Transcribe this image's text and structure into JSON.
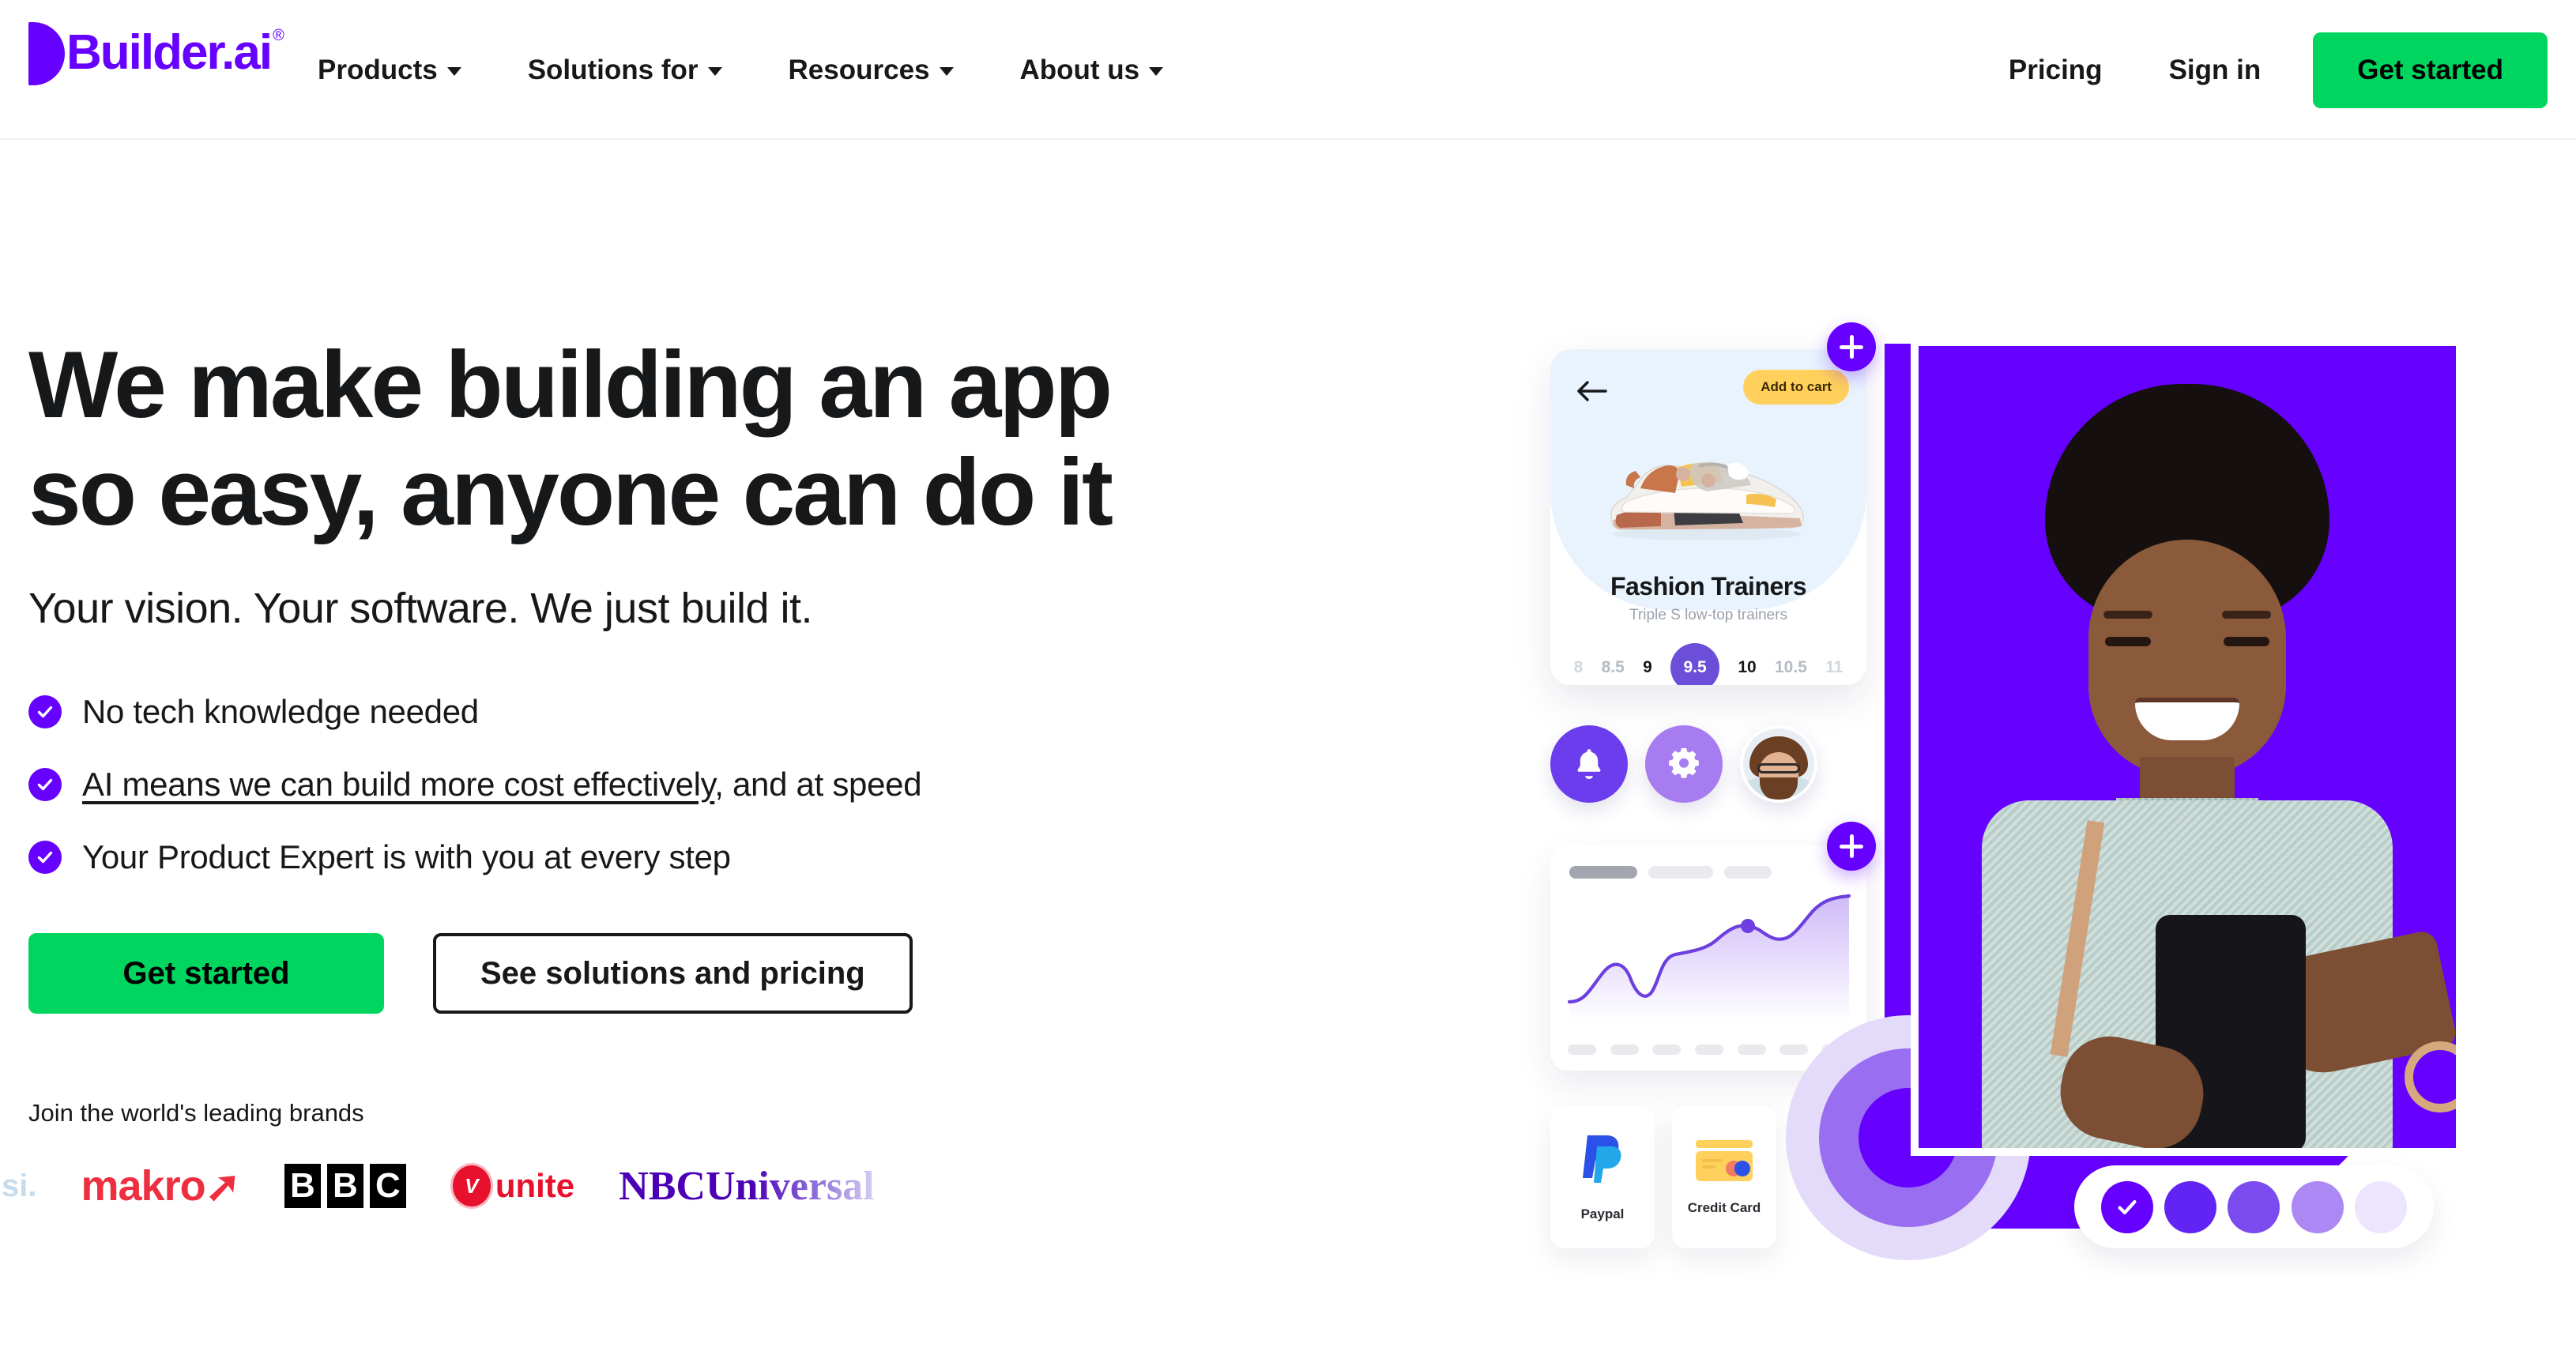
{
  "header": {
    "logo": {
      "text": "Builder.ai",
      "trademark": "®",
      "color": "#6600ff"
    },
    "nav": [
      {
        "label": "Products",
        "has_dropdown": true
      },
      {
        "label": "Solutions for",
        "has_dropdown": true
      },
      {
        "label": "Resources",
        "has_dropdown": true
      },
      {
        "label": "About us",
        "has_dropdown": true
      }
    ],
    "pricing_label": "Pricing",
    "signin_label": "Sign in",
    "get_started_label": "Get started",
    "cta_color": "#00d65f"
  },
  "hero": {
    "headline": "We make building an app\nso easy, anyone can do it",
    "subhead": "Your vision. Your software. We just build it.",
    "checklist": [
      {
        "text": "No tech knowledge needed",
        "underlined": ""
      },
      {
        "underlined": "AI means we can build more cost effectively",
        "text": ", and at speed"
      },
      {
        "text": "Your Product Expert is with you at every step",
        "underlined": ""
      }
    ],
    "primary_cta": "Get started",
    "secondary_cta": "See solutions and pricing",
    "brands_label": "Join the world's leading brands",
    "brands": [
      {
        "name": "pepsi",
        "text": "si.",
        "color": "#c6dcec"
      },
      {
        "name": "makro",
        "text": "makro",
        "color": "#ee2f3f"
      },
      {
        "name": "bbc",
        "letters": [
          "B",
          "B",
          "C"
        ],
        "color": "#000000"
      },
      {
        "name": "virgin-unite",
        "mark": "V",
        "text": "unite",
        "color": "#e8112d"
      },
      {
        "name": "nbcuniversal",
        "text": "NBCUniversal",
        "color": "#4b00b5"
      }
    ]
  },
  "illustration": {
    "shoe_card": {
      "back_icon": "arrow-left-icon",
      "add_to_cart": "Add to cart",
      "title": "Fashion Trainers",
      "subtitle": "Triple S low-top trainers",
      "sizes": [
        "8",
        "8.5",
        "9",
        "9.5",
        "10",
        "10.5",
        "11"
      ],
      "selected_size": "9.5",
      "selected_color": "#6c4fd8"
    },
    "icons": [
      {
        "name": "bell-icon",
        "bg": "#6c3dec"
      },
      {
        "name": "gear-icon",
        "bg": "#a77cf0"
      },
      {
        "name": "avatar",
        "bg": "#e9eef4"
      }
    ],
    "chart_card": {
      "tabs": 3,
      "active_tab": 0,
      "xlabels": 7,
      "line_color": "#6d3fe0",
      "point_color": "#6d3fe0"
    },
    "payments": [
      {
        "label": "Paypal",
        "icon": "paypal-icon"
      },
      {
        "label": "Credit Card",
        "icon": "credit-card-icon"
      }
    ],
    "swatches": [
      {
        "color": "#6600ff",
        "selected": true
      },
      {
        "color": "#6124f5",
        "selected": false
      },
      {
        "color": "#7c4bf0",
        "selected": false
      },
      {
        "color": "#ab88f3",
        "selected": false
      },
      {
        "color": "#ece5fd",
        "selected": false
      }
    ],
    "plus_buttons": 2,
    "brand_shape": "letter-b",
    "brand_shape_color": "#6600ff"
  },
  "chart_data": {
    "type": "area",
    "title": "",
    "xlabel": "",
    "ylabel": "",
    "x": [
      0,
      1,
      2,
      3,
      4,
      5,
      6,
      7,
      8,
      9,
      10
    ],
    "values": [
      12,
      14,
      30,
      38,
      22,
      20,
      48,
      52,
      68,
      60,
      88
    ],
    "ylim": [
      0,
      100
    ],
    "grid": false,
    "legend": "none",
    "highlight_point": {
      "x": 7,
      "y": 68
    },
    "line_color": "#6d3fe0",
    "fill": "linear-gradient purple to transparent"
  }
}
